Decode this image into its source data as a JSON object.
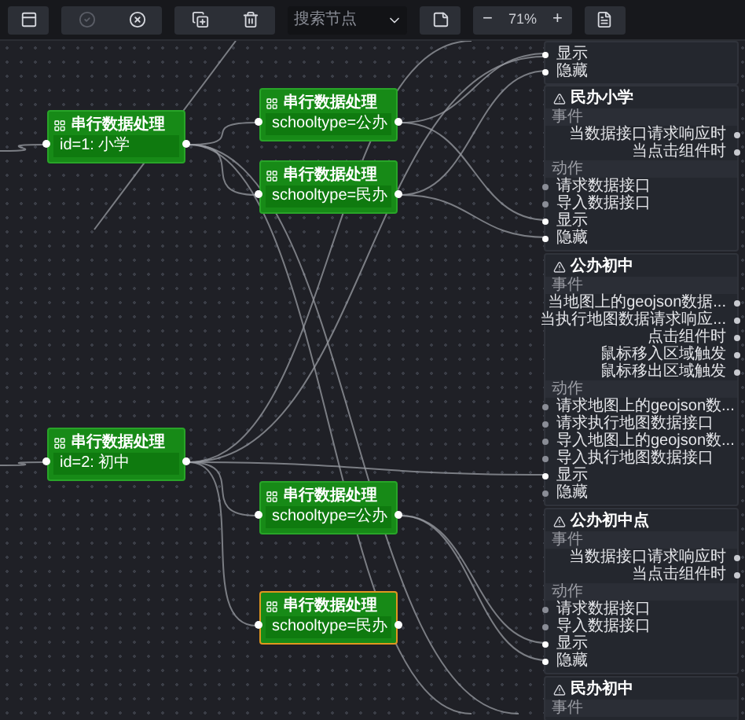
{
  "toolbar": {
    "buttons": [
      {
        "kind": "layout",
        "disabled": false
      },
      {
        "kind": "check",
        "disabled": true
      },
      {
        "kind": "close",
        "disabled": false
      },
      {
        "kind": "copy",
        "disabled": false
      },
      {
        "kind": "delete",
        "disabled": false
      }
    ],
    "search": {
      "placeholder": "搜索节点"
    },
    "note_button": {
      "kind": "note",
      "disabled": false
    },
    "zoom": {
      "minus": "−",
      "value": "71%",
      "plus": "+"
    },
    "file_button": {
      "kind": "file",
      "disabled": false
    }
  },
  "nodes": [
    {
      "title": "串行数据处理",
      "body": "id=1: 小学",
      "selected": false
    },
    {
      "title": "串行数据处理",
      "body": "schooltype=公办",
      "selected": false
    },
    {
      "title": "串行数据处理",
      "body": "schooltype=民办",
      "selected": false
    },
    {
      "title": "串行数据处理",
      "body": "id=2: 初中",
      "selected": false
    },
    {
      "title": "串行数据处理",
      "body": "schooltype=公办",
      "selected": false
    },
    {
      "title": "串行数据处理",
      "body": "schooltype=民办",
      "selected": true
    }
  ],
  "panels": [
    {
      "actions": [
        {
          "label": "显示",
          "connected": true
        },
        {
          "label": "隐藏",
          "connected": true
        }
      ]
    },
    {
      "title": "民办小学",
      "event_label": "事件",
      "events": [
        "当数据接口请求响应时",
        "当点击组件时"
      ],
      "action_label": "动作",
      "actions": [
        {
          "label": "请求数据接口",
          "connected": false
        },
        {
          "label": "导入数据接口",
          "connected": false
        },
        {
          "label": "显示",
          "connected": true
        },
        {
          "label": "隐藏",
          "connected": true
        }
      ]
    },
    {
      "title": "公办初中",
      "event_label": "事件",
      "events": [
        "当地图上的geojson数据...",
        "当执行地图数据请求响应...",
        "点击组件时",
        "鼠标移入区域触发",
        "鼠标移出区域触发"
      ],
      "action_label": "动作",
      "actions": [
        {
          "label": "请求地图上的geojson数...",
          "connected": false
        },
        {
          "label": "请求执行地图数据接口",
          "connected": false
        },
        {
          "label": "导入地图上的geojson数...",
          "connected": false
        },
        {
          "label": "导入执行地图数据接口",
          "connected": false
        },
        {
          "label": "显示",
          "connected": true
        },
        {
          "label": "隐藏",
          "connected": false
        }
      ]
    },
    {
      "title": "公办初中点",
      "event_label": "事件",
      "events": [
        "当数据接口请求响应时",
        "当点击组件时"
      ],
      "action_label": "动作",
      "actions": [
        {
          "label": "请求数据接口",
          "connected": false
        },
        {
          "label": "导入数据接口",
          "connected": false
        },
        {
          "label": "显示",
          "connected": true
        },
        {
          "label": "隐藏",
          "connected": true
        }
      ]
    },
    {
      "title": "民办初中",
      "event_label": "事件"
    }
  ]
}
